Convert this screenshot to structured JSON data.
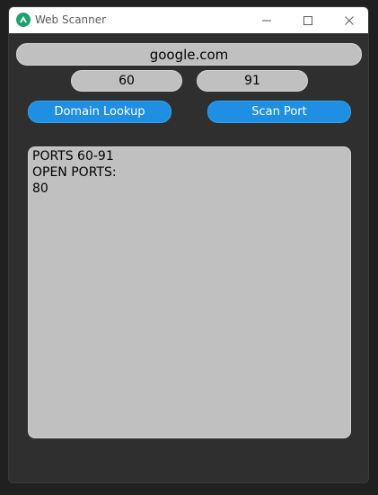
{
  "window": {
    "title": "Web Scanner",
    "icon": "android-app-icon",
    "controls": [
      "minimize-icon",
      "maximize-icon",
      "close-icon"
    ]
  },
  "form": {
    "domain_value": "google.com",
    "port_start_value": "60",
    "port_end_value": "91"
  },
  "buttons": {
    "domain_lookup": "Domain Lookup",
    "scan_port": "Scan Port"
  },
  "output": {
    "lines": [
      "PORTS 60-91",
      "OPEN PORTS:",
      "80"
    ]
  },
  "colors": {
    "accent": "#1f8fe3",
    "background": "#2f2f2f",
    "field": "#c0c0c0"
  }
}
